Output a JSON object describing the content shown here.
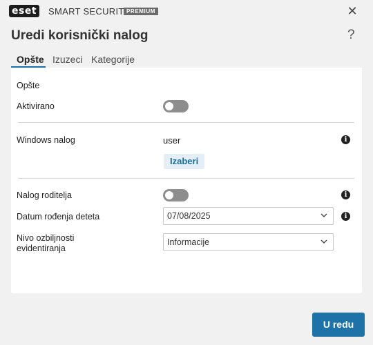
{
  "app": {
    "logo_text": "eset",
    "product_name": "SMART SECURITY",
    "edition_badge": "PREMIUM"
  },
  "dialog": {
    "title": "Uredi korisnički nalog",
    "help_glyph": "?",
    "close_glyph": "✕"
  },
  "tabs": [
    {
      "label": "Opšte",
      "active": true
    },
    {
      "label": "Izuzeci",
      "active": false
    },
    {
      "label": "Kategorije",
      "active": false
    }
  ],
  "general": {
    "section_title": "Opšte",
    "enabled_label": "Aktivirano",
    "enabled_on": false,
    "windows_account_label": "Windows nalog",
    "windows_account_value": "user",
    "choose_button": "Izaberi",
    "parent_account_label": "Nalog roditelja",
    "parent_account_on": false,
    "child_birthdate_label": "Datum rođenja deteta",
    "child_birthdate_value": "07/08/2025",
    "logging_severity_label_line1": "Nivo ozbiljnosti",
    "logging_severity_label_line2": "evidentiranja",
    "logging_severity_value": "Informacije"
  },
  "footer": {
    "ok_button": "U redu"
  },
  "icons": {
    "close": "close-icon",
    "help": "help-icon",
    "info": "info-icon",
    "chevron": "chevron-down-icon"
  },
  "colors": {
    "accent": "#1d72a8",
    "logo_accent": "#1aa3b8",
    "toggle_off": "#8d8d8d"
  }
}
